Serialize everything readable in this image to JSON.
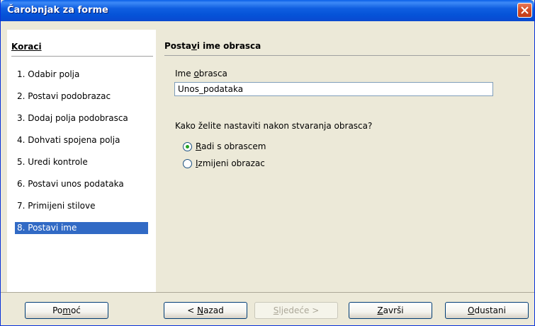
{
  "window": {
    "title": "Čarobnjak za forme"
  },
  "steps": {
    "title": "Koraci",
    "items": [
      {
        "label": "1. Odabir polja"
      },
      {
        "label": "2. Postavi podobrazac"
      },
      {
        "label": "3. Dodaj polja podobrasca"
      },
      {
        "label": "4. Dohvati spojena polja"
      },
      {
        "label": "5. Uredi kontrole"
      },
      {
        "label": "6. Postavi unos podataka"
      },
      {
        "label": "7. Primijeni stilove"
      },
      {
        "label": "8. Postavi ime"
      }
    ],
    "active_index": 7
  },
  "content": {
    "title_pre": "Posta",
    "title_accel": "v",
    "title_post": "i ime obrasca",
    "field_label_pre": "Ime ",
    "field_label_accel": "o",
    "field_label_post": "brasca",
    "field_value": "Unos_podataka",
    "question": "Kako želite nastaviti nakon stvaranja obrasca?",
    "options": [
      {
        "accel": "R",
        "rest": "adi s obrascem",
        "checked": true
      },
      {
        "accel": "I",
        "rest": "zmijeni obrazac",
        "checked": false
      }
    ]
  },
  "buttons": {
    "help": {
      "pre": "Po",
      "accel": "m",
      "post": "oć"
    },
    "back": {
      "pre": "< ",
      "accel": "N",
      "post": "azad"
    },
    "next": {
      "pre": "",
      "accel": "S",
      "post": "ljedeće >"
    },
    "finish": {
      "pre": "",
      "accel": "Z",
      "post": "avrši"
    },
    "cancel": {
      "pre": "",
      "accel": "O",
      "post": "dustani"
    }
  }
}
